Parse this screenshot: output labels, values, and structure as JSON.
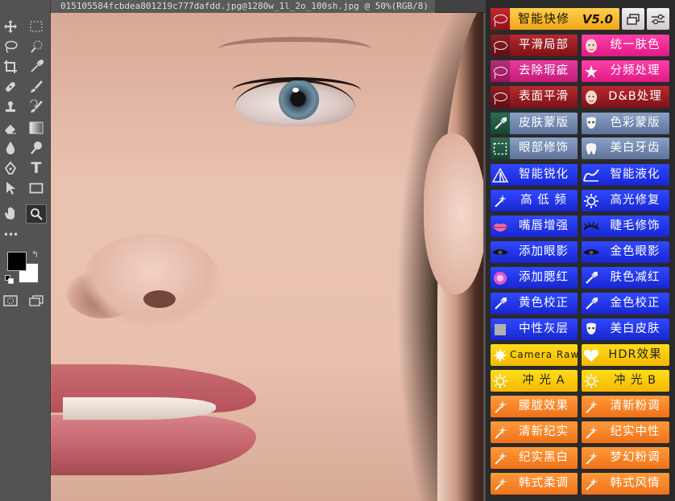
{
  "document": {
    "tab_title": "015105584fcbdea801219c777dafdd.jpg@1280w_1l_2o_100sh.jpg @ 50%(RGB/8)"
  },
  "tools": [
    {
      "name": "move-tool",
      "icon": "move-icon"
    },
    {
      "name": "marquee-tool",
      "icon": "marquee-icon"
    },
    {
      "name": "lasso-tool",
      "icon": "lasso-icon"
    },
    {
      "name": "quick-select-tool",
      "icon": "quick-select-icon"
    },
    {
      "name": "crop-tool",
      "icon": "crop-icon"
    },
    {
      "name": "eyedropper-tool",
      "icon": "eyedropper-icon"
    },
    {
      "name": "healing-brush-tool",
      "icon": "bandage-icon"
    },
    {
      "name": "brush-tool",
      "icon": "brush-icon"
    },
    {
      "name": "clone-stamp-tool",
      "icon": "stamp-icon"
    },
    {
      "name": "history-brush-tool",
      "icon": "history-brush-icon"
    },
    {
      "name": "eraser-tool",
      "icon": "eraser-icon"
    },
    {
      "name": "gradient-tool",
      "icon": "gradient-icon"
    },
    {
      "name": "blur-tool",
      "icon": "drop-icon"
    },
    {
      "name": "dodge-tool",
      "icon": "dodge-icon"
    },
    {
      "name": "pen-tool",
      "icon": "pen-icon"
    },
    {
      "name": "type-tool",
      "icon": "type-icon"
    },
    {
      "name": "path-select-tool",
      "icon": "arrow-icon"
    },
    {
      "name": "shape-tool",
      "icon": "rectangle-icon"
    },
    {
      "name": "hand-tool",
      "icon": "hand-icon"
    },
    {
      "name": "zoom-tool",
      "icon": "zoom-icon"
    }
  ],
  "type_tool_glyph": "T",
  "more_tools_glyph": "•••",
  "swap_colors_glyph": "↰",
  "colors": {
    "foreground": "#000000",
    "background": "#ffffff",
    "panel_bg": "#2a2a2a",
    "toolbar_bg": "#535353"
  },
  "panel": {
    "header": {
      "label": "智能快修",
      "version": "V5.0"
    },
    "buttons": [
      {
        "label": "平滑局部",
        "icon": "lasso-icon",
        "color": "c-dkred"
      },
      {
        "label": "统一肤色",
        "icon": "face-icon",
        "color": "c-mag"
      },
      {
        "label": "去除瑕疵",
        "icon": "lasso-icon",
        "color": "c-mag2"
      },
      {
        "label": "分频处理",
        "icon": "star-icon",
        "color": "c-mag"
      },
      {
        "label": "表面平滑",
        "icon": "lasso-icon",
        "color": "c-dkred"
      },
      {
        "label": "D&B处理",
        "icon": "face-icon",
        "color": "c-dkred"
      },
      {
        "label": "皮肤蒙版",
        "icon": "eyedropper-icon",
        "color": "c-gray"
      },
      {
        "label": "色彩蒙版",
        "icon": "mask-icon",
        "color": "c-gray"
      },
      {
        "label": "眼部修饰",
        "icon": "selection-icon",
        "color": "c-gray"
      },
      {
        "label": "美白牙齿",
        "icon": "tooth-icon",
        "color": "c-gray"
      },
      {
        "label": "智能锐化",
        "icon": "triangle-icon",
        "color": "c-blue"
      },
      {
        "label": "智能液化",
        "icon": "liquify-icon",
        "color": "c-blue"
      },
      {
        "label": "高 低 频",
        "icon": "wand-icon",
        "color": "c-blue"
      },
      {
        "label": "高光修复",
        "icon": "sun-icon",
        "color": "c-blue"
      },
      {
        "label": "嘴唇增强",
        "icon": "lips-icon",
        "color": "c-blue"
      },
      {
        "label": "睫毛修饰",
        "icon": "eyelash-icon",
        "color": "c-blue"
      },
      {
        "label": "添加眼影",
        "icon": "eye-icon",
        "color": "c-blue"
      },
      {
        "label": "金色眼影",
        "icon": "eye-icon",
        "color": "c-blue"
      },
      {
        "label": "添加腮红",
        "icon": "blush-icon",
        "color": "c-blue"
      },
      {
        "label": "肤色减红",
        "icon": "eyedropper-icon",
        "color": "c-blue"
      },
      {
        "label": "黄色校正",
        "icon": "eyedropper-icon",
        "color": "c-blue"
      },
      {
        "label": "金色校正",
        "icon": "eyedropper-icon",
        "color": "c-blue"
      },
      {
        "label": "中性灰层",
        "icon": "square-icon",
        "color": "c-blue"
      },
      {
        "label": "美白皮肤",
        "icon": "mask-icon",
        "color": "c-blue"
      },
      {
        "label": "Camera Raw",
        "icon": "aperture-icon",
        "color": "c-yel"
      },
      {
        "label": "HDR效果",
        "icon": "heart-icon",
        "color": "c-yel"
      },
      {
        "label": "冲 光 A",
        "icon": "sun-icon",
        "color": "c-yel"
      },
      {
        "label": "冲 光 B",
        "icon": "sun-icon",
        "color": "c-yel"
      },
      {
        "label": "朦胧效果",
        "icon": "wand-icon",
        "color": "c-or"
      },
      {
        "label": "清新粉调",
        "icon": "wand-icon",
        "color": "c-or"
      },
      {
        "label": "清新纪实",
        "icon": "wand-icon",
        "color": "c-or"
      },
      {
        "label": "纪实中性",
        "icon": "wand-icon",
        "color": "c-or"
      },
      {
        "label": "纪实黑白",
        "icon": "wand-icon",
        "color": "c-or"
      },
      {
        "label": "梦幻粉调",
        "icon": "wand-icon",
        "color": "c-or"
      },
      {
        "label": "韩式柔调",
        "icon": "wand-icon",
        "color": "c-or"
      },
      {
        "label": "韩式风情",
        "icon": "wand-icon",
        "color": "c-or"
      }
    ]
  }
}
